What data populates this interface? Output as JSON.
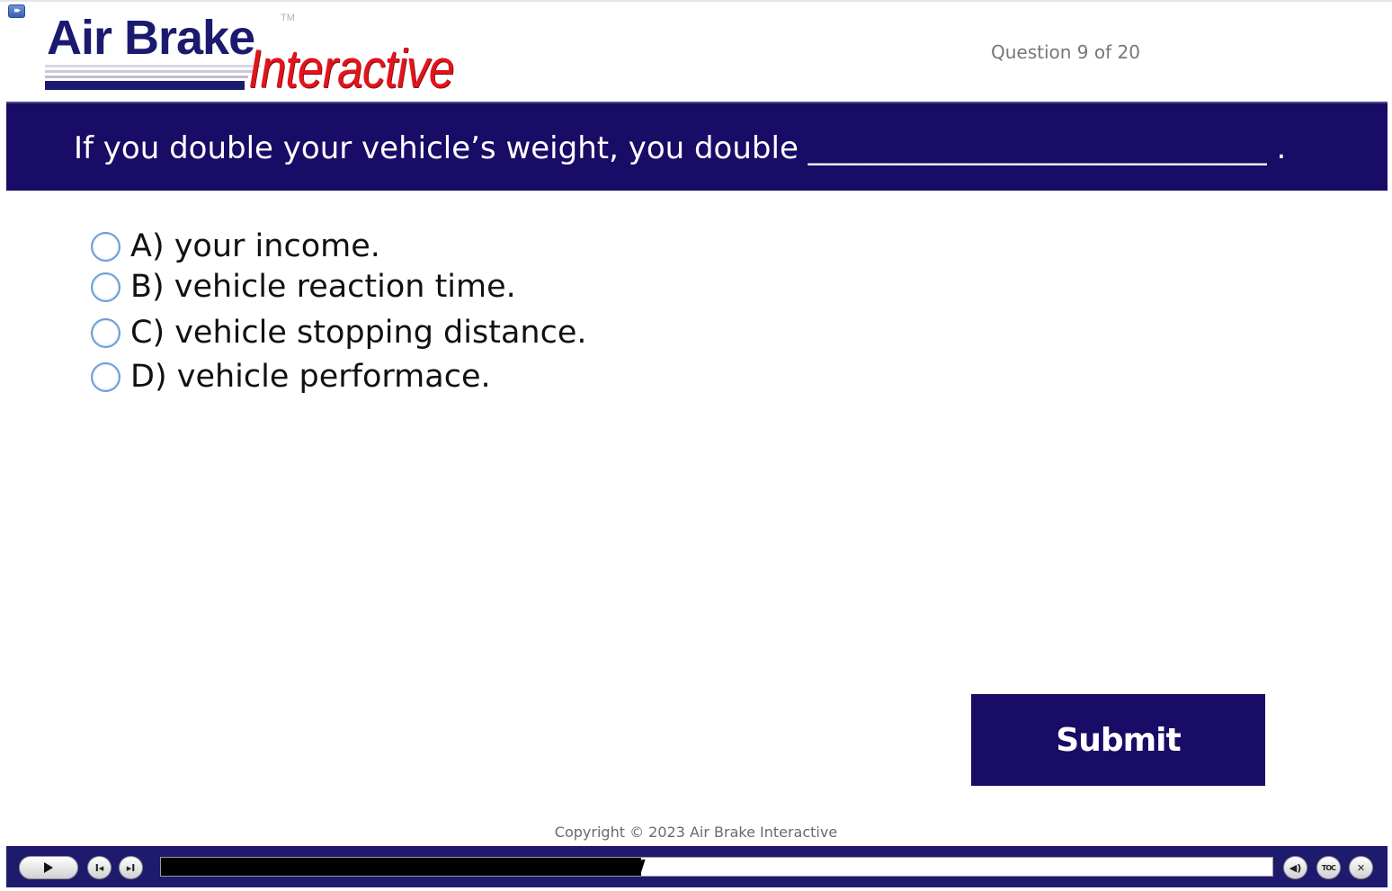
{
  "header": {
    "logo": {
      "brand_primary": "Air Brake",
      "brand_secondary": "Interactive",
      "trademark": "TM"
    },
    "question_counter": "Question 9 of 20"
  },
  "question": {
    "text": "If you double your vehicle’s weight, you double ______________________________ ."
  },
  "options": [
    {
      "label": "A) your income.",
      "selected": false
    },
    {
      "label": "B) vehicle reaction time.",
      "selected": false
    },
    {
      "label": "C) vehicle stopping distance.",
      "selected": false
    },
    {
      "label": "D) vehicle performace.",
      "selected": false
    }
  ],
  "submit": {
    "label": "Submit"
  },
  "footer": {
    "copyright": "Copyright © 2023 Air Brake Interactive"
  },
  "player": {
    "progress": 0.432,
    "toc_label": "TOC",
    "icons": {
      "play": "play-icon",
      "prev": "skip-back-icon",
      "next": "skip-forward-icon",
      "audio": "speaker-icon",
      "close": "close-icon"
    }
  },
  "colors": {
    "brand_navy": "#180c66",
    "logo_red": "#e2141b",
    "radio_border": "#6a9fd4"
  }
}
